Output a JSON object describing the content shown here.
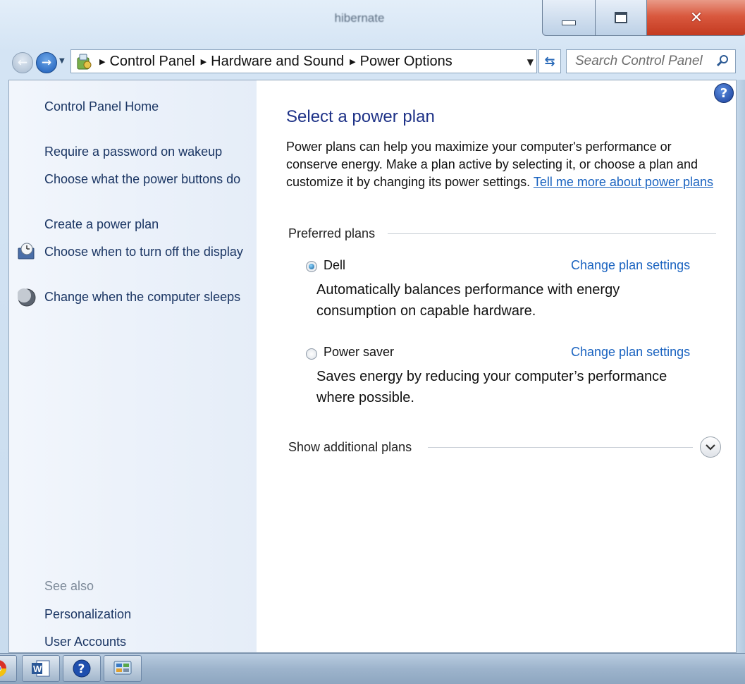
{
  "window": {
    "title": "hibernate"
  },
  "address": {
    "crumbs": [
      "Control Panel",
      "Hardware and Sound",
      "Power Options"
    ]
  },
  "search": {
    "placeholder": "Search Control Panel"
  },
  "sidebar": {
    "home": "Control Panel Home",
    "items": [
      {
        "label": "Require a password on wakeup",
        "icon": "none"
      },
      {
        "label": "Choose what the power buttons do",
        "icon": "none"
      },
      {
        "label": "Create a power plan",
        "icon": "none"
      },
      {
        "label": "Choose when to turn off the display",
        "icon": "monitor-clock-icon"
      },
      {
        "label": "Change when the computer sleeps",
        "icon": "moon-icon"
      }
    ],
    "see_also": "See also",
    "see_also_links": [
      "Personalization",
      "User Accounts"
    ]
  },
  "main": {
    "title": "Select a power plan",
    "intro": "Power plans can help you maximize your computer's performance or conserve energy. Make a plan active by selecting it, or choose a plan and customize it by changing its power settings.",
    "intro_link": "Tell me more about power plans",
    "preferred_heading": "Preferred plans",
    "plans": [
      {
        "name": "Dell",
        "selected": true,
        "change_link": "Change plan settings",
        "description": "Automatically balances performance with energy consumption on capable hardware."
      },
      {
        "name": "Power saver",
        "selected": false,
        "change_link": "Change plan settings",
        "description": "Saves energy by reducing your computer’s performance where possible."
      }
    ],
    "additional_heading": "Show additional plans"
  },
  "taskbar": {
    "items": [
      "chrome-icon",
      "word-icon",
      "help-icon",
      "control-panel-icon"
    ]
  },
  "colors": {
    "accent_title": "#1e3287",
    "link": "#1a63c0",
    "sidebar_link": "#1a3563"
  }
}
